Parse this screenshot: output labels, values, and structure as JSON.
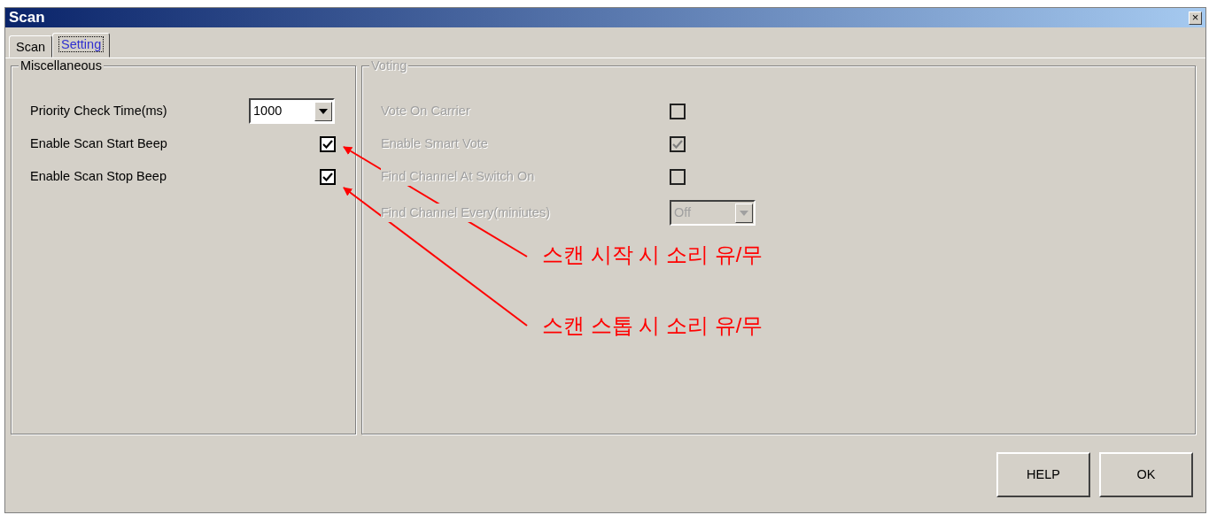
{
  "window": {
    "title": "Scan",
    "close": "×"
  },
  "tabs": [
    {
      "label": "Scan",
      "selected": false
    },
    {
      "label": "Setting",
      "selected": true
    }
  ],
  "groups": [
    {
      "title": "Miscellaneous",
      "disabled": false,
      "rows": [
        {
          "kind": "dropdown",
          "label": "Priority Check Time(ms)",
          "value": "1000"
        },
        {
          "kind": "checkbox",
          "label": "Enable Scan Start Beep",
          "checked": true
        },
        {
          "kind": "checkbox",
          "label": "Enable Scan Stop Beep",
          "checked": true
        }
      ]
    },
    {
      "title": "Voting",
      "disabled": true,
      "rows": [
        {
          "kind": "checkbox",
          "label": "Vote On Carrier",
          "checked": false
        },
        {
          "kind": "checkbox",
          "label": "Enable Smart Vote",
          "checked": true
        },
        {
          "kind": "checkbox",
          "label": "Find Channel At Switch On",
          "checked": false
        },
        {
          "kind": "dropdown",
          "label": "Find Channel Every(miniutes)",
          "value": "Off"
        }
      ]
    }
  ],
  "buttons": [
    "HELP",
    "OK"
  ],
  "annotations": [
    {
      "text": "스캔 시작 시 소리 유/무"
    },
    {
      "text": "스캔 스톱 시 소리 유/무"
    }
  ]
}
